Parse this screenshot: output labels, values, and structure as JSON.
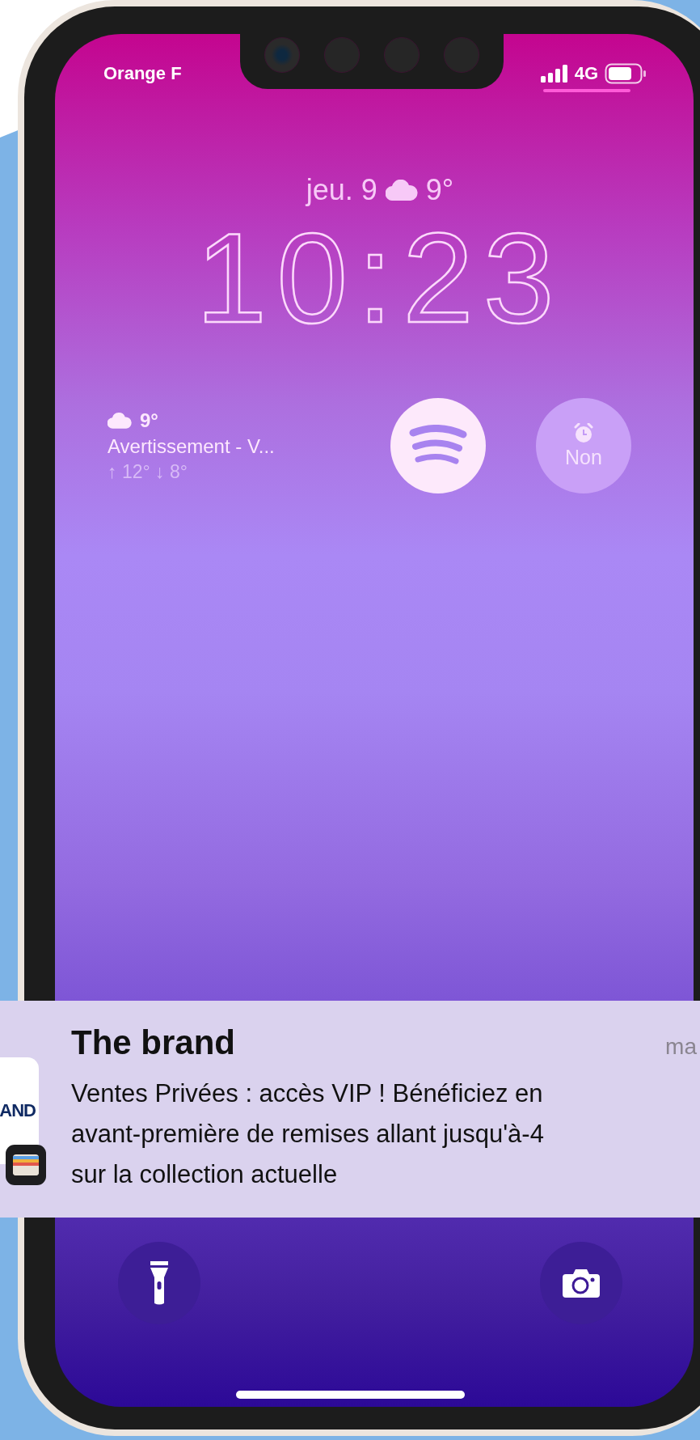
{
  "status_bar": {
    "carrier": "Orange F",
    "network": "4G"
  },
  "lock_screen": {
    "date": "jeu. 9",
    "date_temperature": "9°",
    "time": "10:23"
  },
  "widgets": {
    "weather": {
      "temperature": "9°",
      "alert": "Avertissement - V...",
      "range": "↑ 12° ↓ 8°"
    },
    "alarm": {
      "label": "Non"
    }
  },
  "notification": {
    "app_logo_text": "AND",
    "title": "The brand",
    "time": "ma",
    "body_lines": [
      "Ventes Privées : accès VIP ! Bénéficiez en",
      "avant-première de remises allant jusqu'à-4",
      "sur la collection actuelle"
    ]
  }
}
